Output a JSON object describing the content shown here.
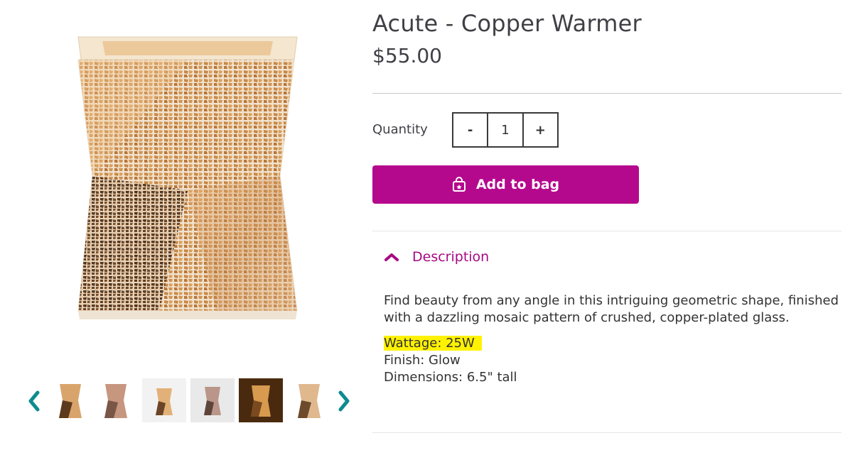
{
  "product": {
    "title": "Acute - Copper Warmer",
    "price": "$55.00"
  },
  "quantity": {
    "label": "Quantity",
    "decrement": "-",
    "value": "1",
    "increment": "+"
  },
  "add_to_bag": {
    "label": "Add to bag",
    "icon": "shopping-bag-icon",
    "color": "#b5098d"
  },
  "description": {
    "toggle_label": "Description",
    "toggle_icon": "chevron-up-icon",
    "text": "Find beauty from any angle in this intriguing geometric shape, finished with a dazzling mosaic pattern of crushed, copper-plated glass.",
    "wattage": "Wattage: 25W",
    "finish": "Finish: Glow",
    "dimensions": "Dimensions: 6.5\" tall"
  },
  "gallery": {
    "prev_icon": "chevron-left-icon",
    "next_icon": "chevron-right-icon",
    "thumbnails": [
      "thumbnail-1",
      "thumbnail-2",
      "thumbnail-3",
      "thumbnail-4",
      "thumbnail-5",
      "thumbnail-6"
    ]
  },
  "colors": {
    "accent": "#b5098d",
    "arrow": "#0f8a8f",
    "highlight": "#fff200"
  }
}
